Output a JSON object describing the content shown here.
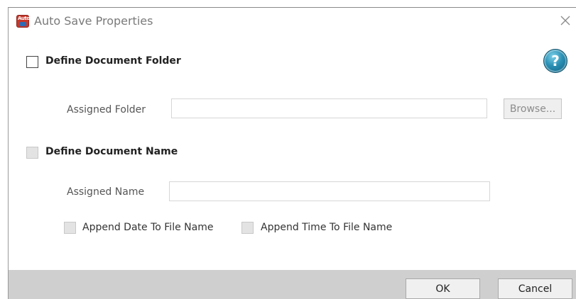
{
  "window": {
    "title": "Auto Save Properties",
    "icon": "auto-save-app-icon",
    "icon_text": "Auto"
  },
  "folder_section": {
    "checkbox_label": "Define Document Folder",
    "checked": false,
    "assigned_folder_label": "Assigned Folder",
    "assigned_folder_value": "",
    "browse_label": "Browse..."
  },
  "name_section": {
    "checkbox_label": "Define Document Name",
    "checked": false,
    "assigned_name_label": "Assigned Name",
    "assigned_name_value": "",
    "append_date_label": "Append Date To File Name",
    "append_time_label": "Append Time To File Name"
  },
  "help": {
    "icon": "help-icon",
    "glyph": "?"
  },
  "footer": {
    "ok_label": "OK",
    "cancel_label": "Cancel"
  },
  "colors": {
    "footer_bg": "#cfcfcf",
    "help_blue": "#2a8fb3",
    "app_icon_red": "#c8382b"
  }
}
